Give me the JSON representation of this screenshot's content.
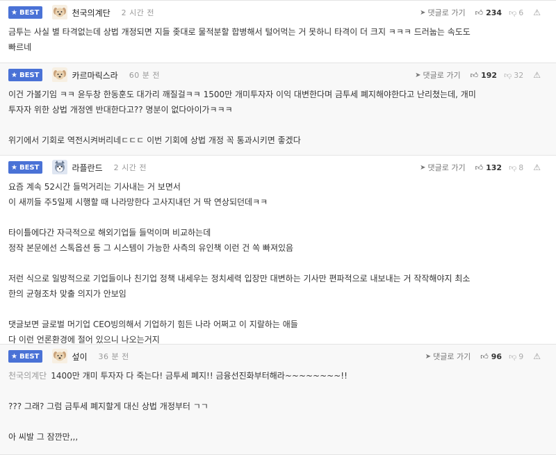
{
  "comments": [
    {
      "badge": "BEST",
      "nickname": "천국의계단",
      "time": "2 시간 전",
      "reply_label": "댓글로 가기",
      "up_count": "234",
      "down_count": "6",
      "avatar_icon": "dog-icon",
      "lines": [
        "금투는 사실 별 타격없는데 상법 개정되면 지들 좆대로 물적분할 합병해서 털어먹는 거 못하니 타격이 더 크지 ㅋㅋㅋ 드러눕는 속도도",
        "빠르네"
      ]
    },
    {
      "badge": "BEST",
      "nickname": "카르마릭스라",
      "time": "60 분 전",
      "reply_label": "댓글로 가기",
      "up_count": "192",
      "down_count": "32",
      "avatar_icon": "dog-icon",
      "lines": [
        "이건 가볼기임 ㅋㅋ 윤두창 한동훈도 대가리 깨질걸ㅋㅋ 1500만 개미투자자 이익 대변한다며 금투세 폐지해야한다고 난리쳤는데, 개미",
        "투자자 위한 상법 개정엔 반대한다고?? 명분이 없다아이가ㅋㅋㅋ",
        "",
        "위기에서 기회로 역전시켜버리네ㄷㄷㄷ 이번 기회에 상법 개정 꼭 통과시키면 좋겠다"
      ]
    },
    {
      "badge": "BEST",
      "nickname": "라플란드",
      "time": "2 시간 전",
      "reply_label": "댓글로 가기",
      "up_count": "132",
      "down_count": "8",
      "avatar_icon": "husky-icon",
      "lines": [
        "요즘 계속 52시간 들먹거리는 기사내는 거 보면서",
        "이 새끼들 주5일제 시행할 때 나라망한다 고사지내던 거 딱 연상되던데ㅋㅋ",
        "",
        "타이틀에다간 자극적으로 해외기업들 들먹이며 비교하는데",
        "정작 본문에선 스톡옵션 등 그 시스템이 가능한 사측의 유인책 이런 건 쏙 빠져있음",
        "",
        "저런 식으로 일방적으로 기업들이나 친기업 정책 내세우는 정치세력 입장만 대변하는 기사만 편파적으로 내보내는 거 작작해야지 최소",
        "한의 균형조차 맞출 의지가 안보임",
        "",
        "댓글보면 글로벌 머기업 CEO빙의해서 기업하기 힘든 나라 어쩌고 이 지랄하는 애들",
        "다 이런 언론환경에 절어 있으니 나오는거지"
      ]
    },
    {
      "badge": "BEST",
      "nickname": "섶이",
      "time": "36 분 전",
      "reply_label": "댓글로 가기",
      "up_count": "96",
      "down_count": "9",
      "avatar_icon": "dog-icon",
      "quote_name": "천국의계단",
      "lines": [
        "1400만 개미 투자자 다 죽는다! 금투세 폐지!! 금융선진화부터해라~~~~~~~~!!",
        "",
        "??? 그래? 그럼 금투세 폐지할게 대신 상법 개정부터 ㄱㄱ",
        "",
        "아 씨발 그 잠깐만,,,"
      ]
    }
  ],
  "colors": {
    "badge_bg": "#4a72d6",
    "alt_row_bg": "#f8f8f8"
  }
}
